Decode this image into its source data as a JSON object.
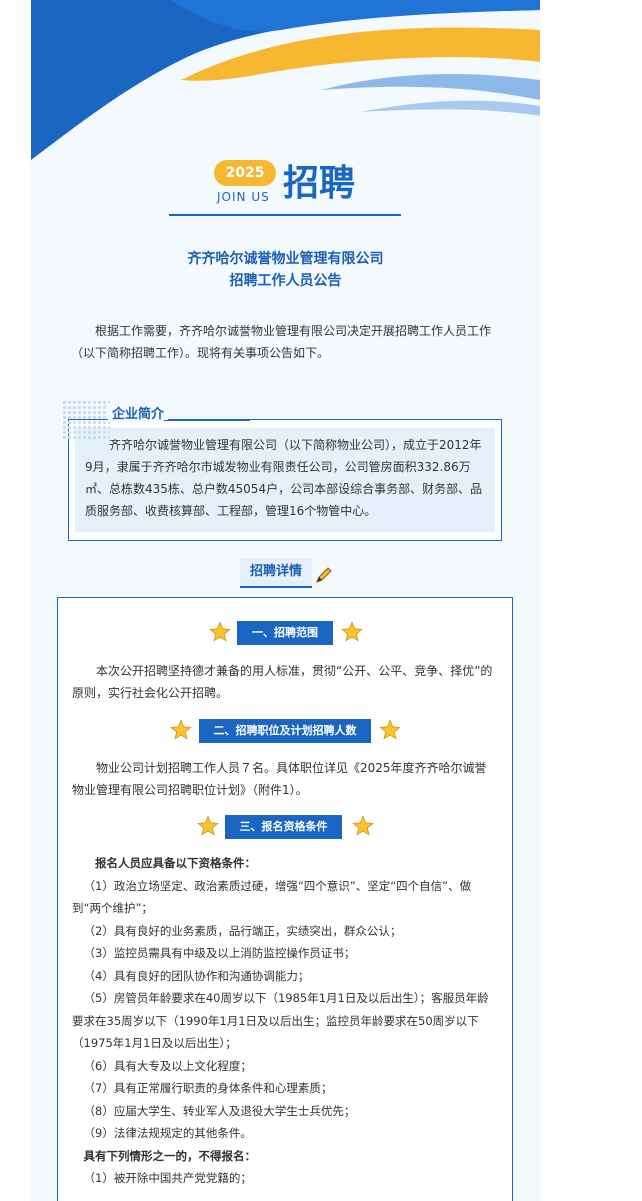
{
  "header": {
    "year": "2025",
    "join_us": "JOIN US",
    "title": "招聘"
  },
  "company_title": {
    "line1": "齐齐哈尔诚誉物业管理有限公司",
    "line2": "招聘工作人员公告"
  },
  "intro": "根据工作需要，齐齐哈尔诚誉物业管理有限公司决定开展招聘工作人员工作（以下简称招聘工作）。现将有关事项公告如下。",
  "company_profile": {
    "label": "企业简介",
    "text": "齐齐哈尔诚誉物业管理有限公司（以下简称物业公司），成立于2012年9月，隶属于齐齐哈尔市城发物业有限责任公司，公司管房面积332.86万㎡、总栋数435栋、总户数45054户，公司本部设综合事务部、财务部、品质服务部、收费核算部、工程部，管理16个物管中心。"
  },
  "details": {
    "tab_label": "招聘详情",
    "sections": [
      {
        "label": "一、招聘范围",
        "text": "本次公开招聘坚持德才兼备的用人标准，贯彻“公开、公平、竞争、择优”的原则，实行社会化公开招聘。"
      },
      {
        "label": "二、招聘职位及计划招聘人数",
        "text": "物业公司计划招聘工作人员７名。具体职位详见《2025年度齐齐哈尔诚誉物业管理有限公司招聘职位计划》（附件1）。"
      },
      {
        "label": "三、报名资格条件",
        "heading": "报名人员应具备以下资格条件：",
        "items": [
          "（1）政治立场坚定、政治素质过硬，增强“四个意识”、坚定“四个自信”、做到“两个维护”；",
          "（2）具有良好的业务素质，品行端正，实绩突出，群众公认；",
          "（3）监控员需具有中级及以上消防监控操作员证书；",
          "（4）具有良好的团队协作和沟通协调能力；",
          "（5）房管员年龄要求在40周岁以下（1985年1月1日及以后出生）；客服员年龄要求在35周岁以下（1990年1月1日及以后出生；监控员年龄要求在50周岁以下（1975年1月1日及以后出生）；",
          "（6）具有大专及以上文化程度；",
          "（7）具有正常履行职责的身体条件和心理素质；",
          "（8）应届大学生、转业军人及退役大学生士兵优先；",
          "（9）法律法规规定的其他条件。"
        ],
        "exclusion_heading": "具有下列情形之一的，不得报名：",
        "exclusion_items": [
          "（1）被开除中国共产党党籍的；"
        ]
      }
    ]
  },
  "colors": {
    "primary_blue": "#1a66c2",
    "accent_gold": "#f6b731",
    "light_blue": "#e6f0fb"
  }
}
